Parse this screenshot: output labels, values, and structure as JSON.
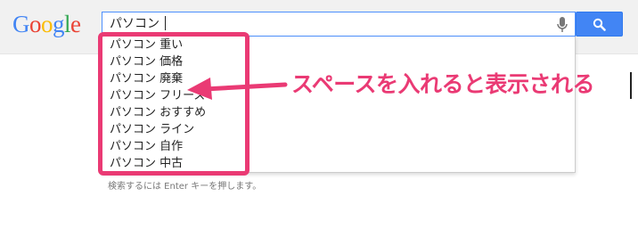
{
  "logo": {
    "letters": [
      "G",
      "o",
      "o",
      "g",
      "l",
      "e"
    ],
    "colors": [
      "#4285f4",
      "#ea4335",
      "#fbbc05",
      "#4285f4",
      "#34a853",
      "#ea4335"
    ]
  },
  "search": {
    "value": "パソコン"
  },
  "suggestions": [
    "パソコン 重い",
    "パソコン 価格",
    "パソコン 廃棄",
    "パソコン フリーズ",
    "パソコン おすすめ",
    "パソコン ライン",
    "パソコン 自作",
    "パソコン 中古"
  ],
  "hint": "検索するには Enter キーを押します。",
  "annotation": {
    "text": "スペースを入れると表示される",
    "color": "#ea3a74"
  },
  "icons": {
    "mic": "microphone-icon",
    "search": "magnifier-icon"
  },
  "colors": {
    "search_button": "#4285f4",
    "input_focus_border": "#4d90fe",
    "annotation": "#ea3a74"
  }
}
